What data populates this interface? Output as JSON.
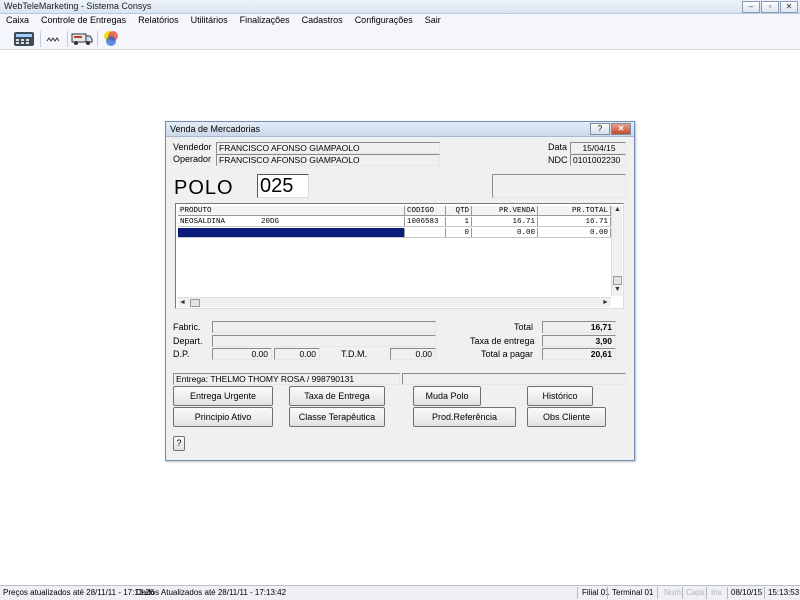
{
  "window": {
    "title": "WebTeleMarketing - Sistema Consys",
    "min": "–",
    "max": "▫",
    "close": "✕"
  },
  "menu": [
    "Caixa",
    "Controle de Entregas",
    "Relatórios",
    "Utilitários",
    "Finalizações",
    "Cadastros",
    "Configurações",
    "Sair"
  ],
  "dialog": {
    "title": "Venda de Mercadorias",
    "help_btn": "?",
    "close_btn": "✕",
    "vendedor_label": "Vendedor",
    "vendedor": "FRANCISCO AFONSO GIAMPAOLO",
    "operador_label": "Operador",
    "operador": "FRANCISCO AFONSO GIAMPAOLO",
    "data_label": "Data",
    "data": "15/04/15",
    "ndc_label": "NDC",
    "ndc": "0101002230",
    "polo_label": "POLO",
    "polo": "025",
    "grid": {
      "headers": [
        "PRODUTO",
        "CODIGO",
        "QTD",
        "PR.VENDA",
        "PR.TOTAL"
      ],
      "rows": [
        {
          "produto": "NEOSALDINA        20DG",
          "codigo": "1006583",
          "qtd": "1",
          "venda": "16.71",
          "total": "16.71"
        },
        {
          "produto": "",
          "codigo": "",
          "qtd": "0",
          "venda": "0.00",
          "total": "0.00"
        }
      ]
    },
    "fabric_label": "Fabric.",
    "depart_label": "Depart.",
    "dp_label": "D.P.",
    "dp1": "0.00",
    "dp2": "0.00",
    "tdm_label": "T.D.M.",
    "tdm": "0.00",
    "total_label": "Total",
    "total": "16,71",
    "taxa_label": "Taxa de entrega",
    "taxa": "3,90",
    "pagar_label": "Total a pagar",
    "pagar": "20,61",
    "entrega": "Entrega: THELMO THOMY ROSA / 998790131",
    "buttons": {
      "entrega_urgente": "Entrega Urgente",
      "taxa_entrega": "Taxa de Entrega",
      "muda_polo": "Muda Polo",
      "historico": "Histórico",
      "principio_ativo": "Principio Ativo",
      "classe_terapeutica": "Classe Terapêutica",
      "prod_referencia": "Prod.Referência",
      "obs_cliente": "Obs Cliente",
      "help": "?"
    }
  },
  "status": {
    "precos": "Preços atualizados até 28/11/11 - 17:13:26",
    "dados": "Dados Atualizados até 28/11/11 - 17:13:42",
    "filial": "Filial 01",
    "terminal": "Terminal 01",
    "num": "Num",
    "caps": "Caps",
    "ins": "Ins",
    "date": "08/10/15",
    "time": "15:13:53"
  }
}
